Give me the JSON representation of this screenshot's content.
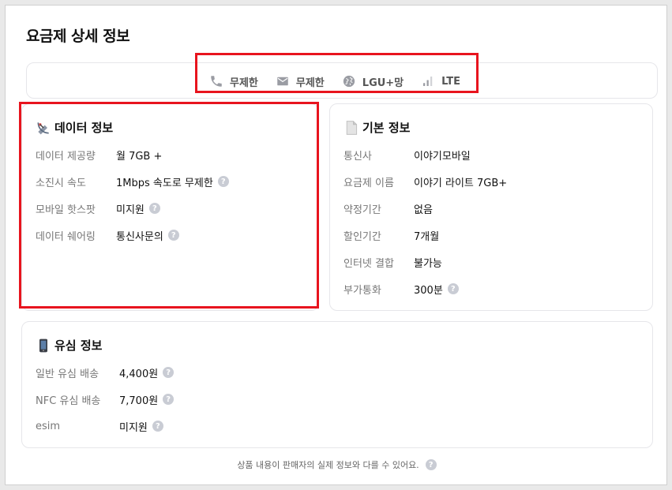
{
  "page": {
    "title": "요금제 상세 정보"
  },
  "summary": {
    "items": [
      {
        "icon": "phone-icon",
        "text": "무제한"
      },
      {
        "icon": "mail-icon",
        "text": "무제한"
      },
      {
        "icon": "globe-icon",
        "text": "LGU+망"
      },
      {
        "icon": "signal-icon",
        "text": "LTE"
      }
    ]
  },
  "data_section": {
    "title": "데이터 정보",
    "icon": "satellite-antenna-icon",
    "rows": [
      {
        "label": "데이터 제공량",
        "value": "월 7GB +",
        "help": false
      },
      {
        "label": "소진시 속도",
        "value": "1Mbps 속도로 무제한",
        "help": true
      },
      {
        "label": "모바일 핫스팟",
        "value": "미지원",
        "help": true
      },
      {
        "label": "데이터 쉐어링",
        "value": "통신사문의",
        "help": true
      }
    ]
  },
  "basic_section": {
    "title": "기본 정보",
    "icon": "document-icon",
    "rows": [
      {
        "label": "통신사",
        "value": "이야기모바일",
        "help": false
      },
      {
        "label": "요금제 이름",
        "value": "이야기 라이트 7GB+",
        "help": false
      },
      {
        "label": "약정기간",
        "value": "없음",
        "help": false
      },
      {
        "label": "할인기간",
        "value": "7개월",
        "help": false
      },
      {
        "label": "인터넷 결합",
        "value": "불가능",
        "help": false
      },
      {
        "label": "부가통화",
        "value": "300분",
        "help": true
      }
    ]
  },
  "usim_section": {
    "title": "유심 정보",
    "icon": "mobile-phone-icon",
    "rows": [
      {
        "label": "일반 유심 배송",
        "value": "4,400원",
        "help": true
      },
      {
        "label": "NFC 유심 배송",
        "value": "7,700원",
        "help": true
      },
      {
        "label": "esim",
        "value": "미지원",
        "help": true
      }
    ]
  },
  "footer": {
    "note": "상품 내용이 판매자의 실제 정보와 다를 수 있어요."
  },
  "colors": {
    "highlight": "#e8141e",
    "help_bg": "#c9ccd4",
    "label": "#777777"
  }
}
